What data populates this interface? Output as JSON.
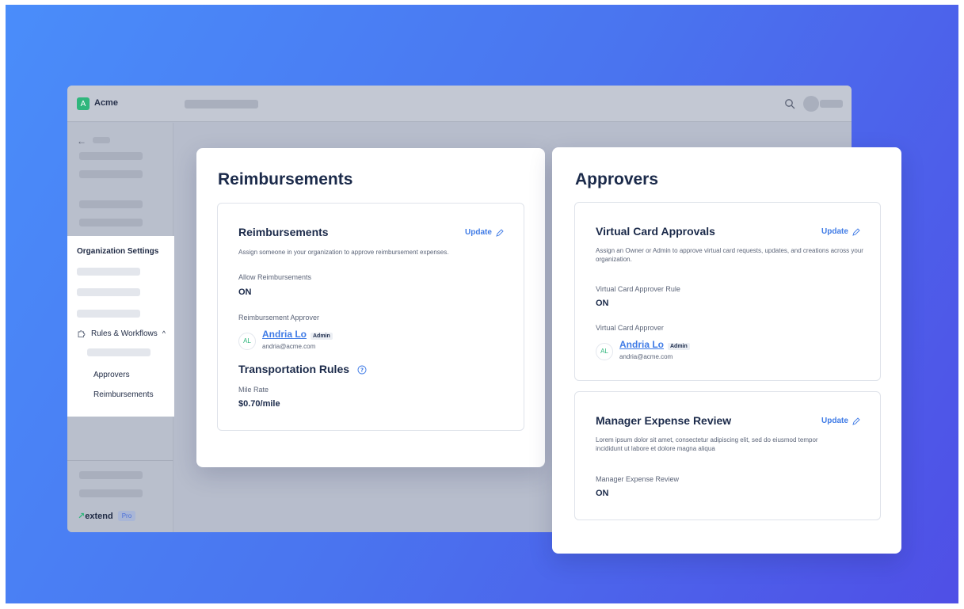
{
  "app": {
    "org_initial": "A",
    "org_name": "Acme"
  },
  "sidebar": {
    "section_title": "Organization Settings",
    "rules_label": "Rules & Workflows",
    "rules_chevron": "^",
    "sub_items": [
      "Approvers",
      "Reimbursements"
    ],
    "brand": "extend",
    "plan_badge": "Pro"
  },
  "reimbursements_card": {
    "title": "Reimbursements",
    "section_title": "Reimbursements",
    "update_label": "Update",
    "description": "Assign someone in your organization to approve reimbursement expenses.",
    "allow_label": "Allow Reimbursements",
    "allow_value": "ON",
    "approver_label": "Reimbursement Approver",
    "approver": {
      "initials": "AL",
      "name": "Andria Lo",
      "role": "Admin",
      "email": "andria@acme.com"
    },
    "transport_title": "Transportation Rules",
    "mile_rate_label": "Mile Rate",
    "mile_rate_value": "$0.70/mile"
  },
  "approvers_card": {
    "title": "Approvers",
    "virtual_card": {
      "title": "Virtual Card Approvals",
      "update_label": "Update",
      "description": "Assign an Owner or Admin to approve virtual card requests, updates, and creations across your organization.",
      "rule_label": "Virtual Card Approver Rule",
      "rule_value": "ON",
      "approver_label": "Virtual Card Approver",
      "approver": {
        "initials": "AL",
        "name": "Andria Lo",
        "role": "Admin",
        "email": "andria@acme.com"
      }
    },
    "manager_review": {
      "title": "Manager Expense Review",
      "update_label": "Update",
      "description": "Lorem ipsum dolor sit amet, consectetur adipiscing elit, sed do eiusmod tempor incididunt ut labore et dolore magna aliqua",
      "review_label": "Manager Expense Review",
      "review_value": "ON"
    }
  },
  "colors": {
    "accent": "#3f7be6",
    "brand_green": "#2fb67c",
    "background_start": "#4a8dfa",
    "background_end": "#4f4fe6"
  },
  "icons": {
    "search": "search-icon",
    "back": "back-arrow-icon",
    "edit": "pencil-icon",
    "info": "info-circle-icon",
    "rules": "puzzle-icon"
  }
}
